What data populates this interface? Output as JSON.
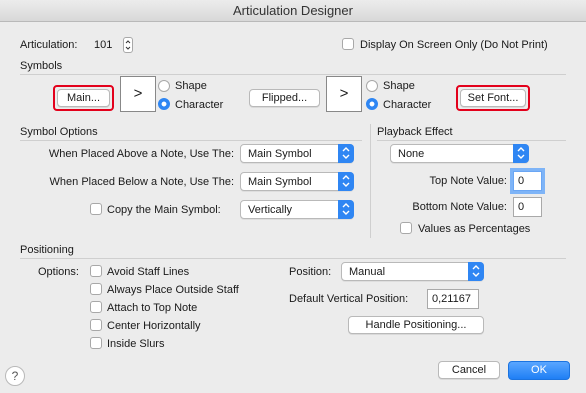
{
  "window": {
    "title": "Articulation Designer"
  },
  "articulation": {
    "label": "Articulation:",
    "value": "101"
  },
  "display_on_screen_only": {
    "label": "Display On Screen Only (Do Not Print)",
    "checked": false
  },
  "symbols": {
    "heading": "Symbols",
    "main_button": "Main...",
    "main_symbol": ">",
    "flipped_button": "Flipped...",
    "flipped_symbol": ">",
    "shape_label": "Shape",
    "character_label": "Character",
    "set_font_button": "Set Font..."
  },
  "symbol_options": {
    "heading": "Symbol Options",
    "above_label": "When Placed Above a Note, Use The:",
    "above_value": "Main Symbol",
    "below_label": "When Placed Below a Note, Use The:",
    "below_value": "Main Symbol",
    "copy_label": "Copy the Main Symbol:",
    "copy_value": "Vertically",
    "copy_checked": false
  },
  "playback": {
    "heading": "Playback Effect",
    "effect_value": "None",
    "top_label": "Top Note Value:",
    "top_value": "0",
    "bottom_label": "Bottom Note Value:",
    "bottom_value": "0",
    "percent_label": "Values as Percentages"
  },
  "positioning": {
    "heading": "Positioning",
    "options_label": "Options:",
    "options": [
      "Avoid Staff Lines",
      "Always Place Outside Staff",
      "Attach to Top Note",
      "Center Horizontally",
      "Inside Slurs"
    ],
    "position_label": "Position:",
    "position_value": "Manual",
    "default_vertical_label": "Default Vertical Position:",
    "default_vertical_value": "0,21167",
    "handle_button": "Handle Positioning..."
  },
  "footer": {
    "help": "?",
    "cancel": "Cancel",
    "ok": "OK"
  },
  "colors": {
    "accent": "#2f86f3",
    "highlight_ring": "#e3001b"
  }
}
